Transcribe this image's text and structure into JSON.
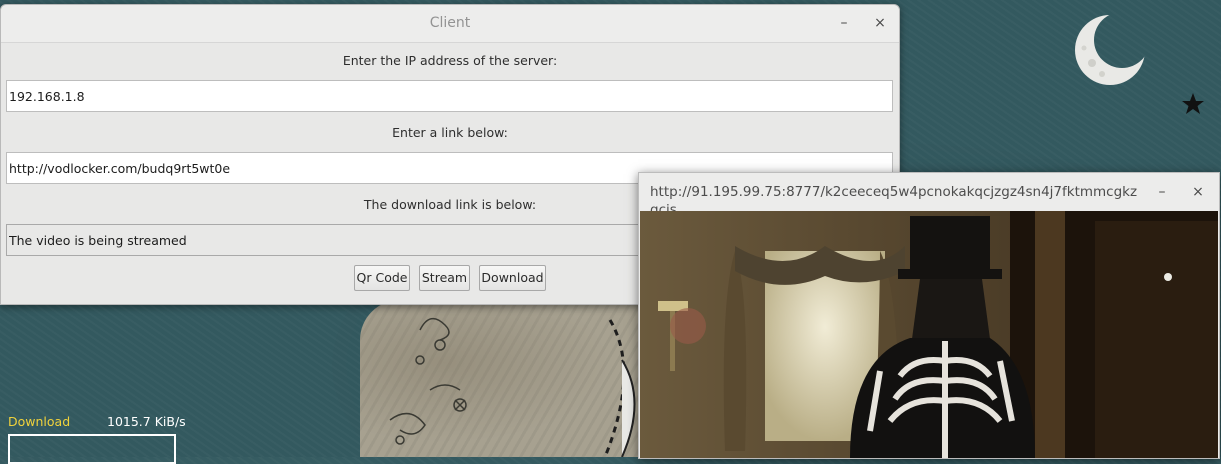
{
  "client": {
    "title": "Client",
    "minimize_label": "–",
    "close_label": "×",
    "ip_label": "Enter the IP address of the server:",
    "ip_value": "192.168.1.8",
    "link_label": "Enter a link below:",
    "link_value": "http://vodlocker.com/budq9rt5wt0e",
    "download_label": "The download link is below:",
    "download_value": "The video is being streamed",
    "buttons": {
      "qr": "Qr Code",
      "stream": "Stream",
      "download": "Download"
    }
  },
  "player": {
    "title": "http://91.195.99.75:8777/k2ceeceq5w4pcnokakqcjzgz4sn4j7fktmmcgkzgcis",
    "minimize_label": "–",
    "close_label": "×"
  },
  "conky": {
    "label": "Download",
    "rate": "1015.7 KiB/s"
  },
  "colors": {
    "desktop": "#33595f",
    "conky_label": "#f0d23c"
  },
  "icons": {
    "moon": "crescent-moon-icon",
    "star": "star-icon"
  }
}
